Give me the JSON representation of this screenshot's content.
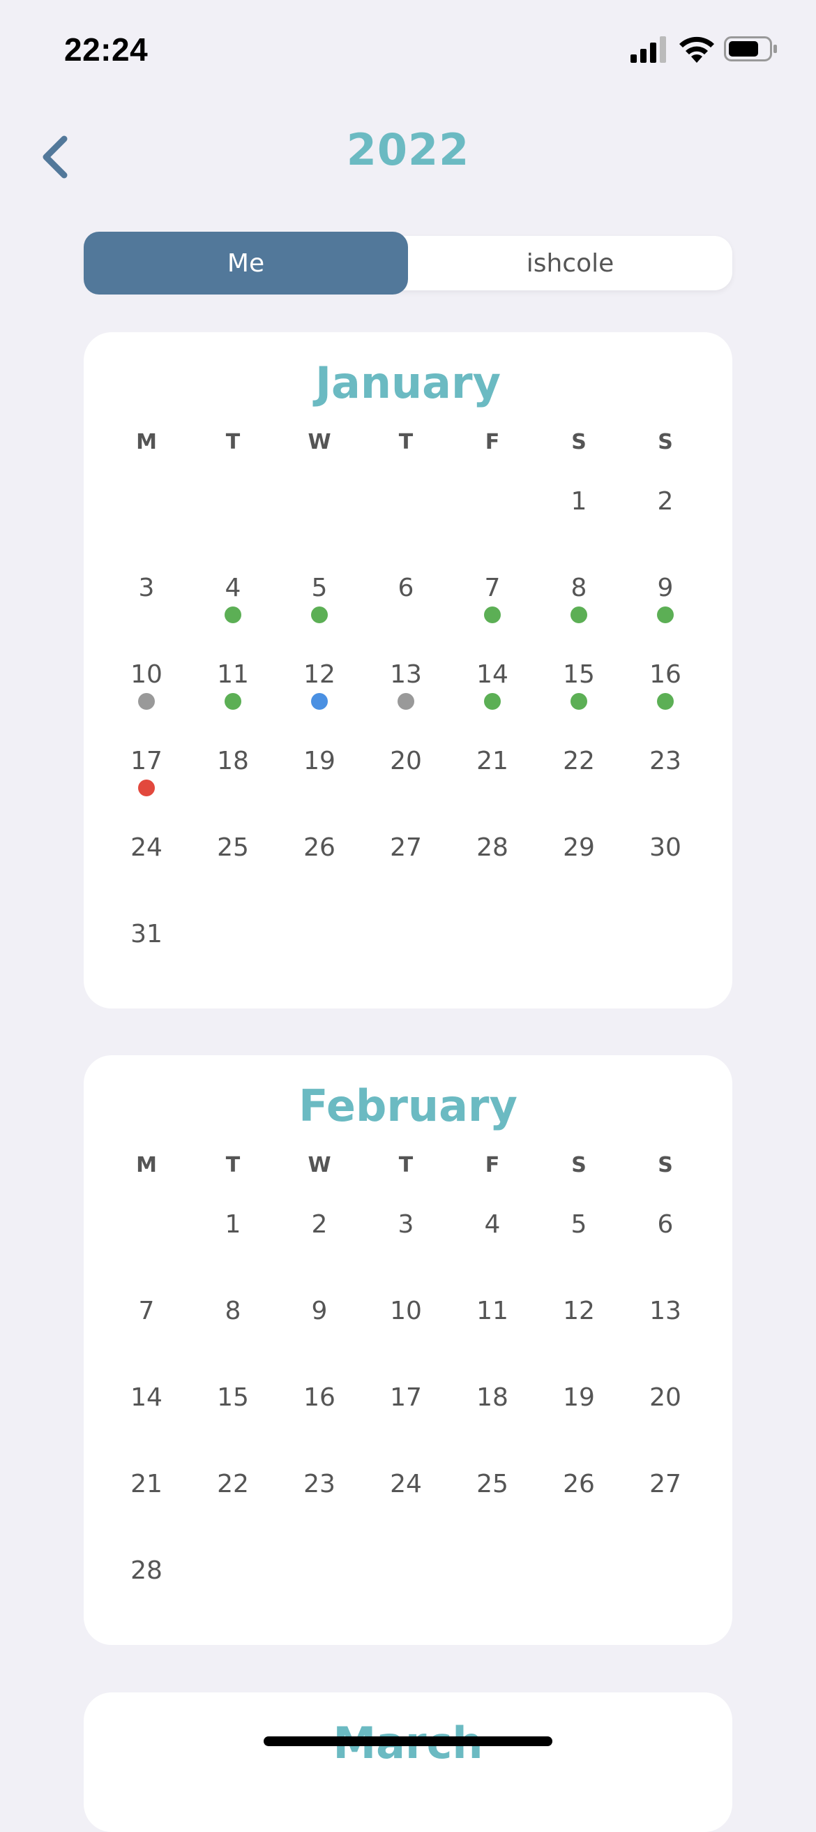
{
  "status": {
    "time": "22:24"
  },
  "header": {
    "title": "2022",
    "back_icon": "chevron-left-icon"
  },
  "segments": {
    "me": "Me",
    "other": "ishcole"
  },
  "weekdays": [
    "M",
    "T",
    "W",
    "T",
    "F",
    "S",
    "S"
  ],
  "colors": {
    "accent": "#6bbac2",
    "selected_segment": "#52789a",
    "dot_green": "#5caf55",
    "dot_gray": "#999999",
    "dot_blue": "#4a90e2",
    "dot_red": "#e2483d"
  },
  "months": [
    {
      "name": "January",
      "weeks": [
        [
          null,
          null,
          null,
          null,
          null,
          {
            "d": "1"
          },
          {
            "d": "2"
          }
        ],
        [
          {
            "d": "3"
          },
          {
            "d": "4",
            "dot": "green"
          },
          {
            "d": "5",
            "dot": "green"
          },
          {
            "d": "6"
          },
          {
            "d": "7",
            "dot": "green"
          },
          {
            "d": "8",
            "dot": "green"
          },
          {
            "d": "9",
            "dot": "green"
          }
        ],
        [
          {
            "d": "10",
            "dot": "gray"
          },
          {
            "d": "11",
            "dot": "green"
          },
          {
            "d": "12",
            "dot": "blue"
          },
          {
            "d": "13",
            "dot": "gray"
          },
          {
            "d": "14",
            "dot": "green"
          },
          {
            "d": "15",
            "dot": "green"
          },
          {
            "d": "16",
            "dot": "green"
          }
        ],
        [
          {
            "d": "17",
            "dot": "red"
          },
          {
            "d": "18"
          },
          {
            "d": "19"
          },
          {
            "d": "20"
          },
          {
            "d": "21"
          },
          {
            "d": "22"
          },
          {
            "d": "23"
          }
        ],
        [
          {
            "d": "24"
          },
          {
            "d": "25"
          },
          {
            "d": "26"
          },
          {
            "d": "27"
          },
          {
            "d": "28"
          },
          {
            "d": "29"
          },
          {
            "d": "30"
          }
        ],
        [
          {
            "d": "31"
          },
          null,
          null,
          null,
          null,
          null,
          null
        ]
      ]
    },
    {
      "name": "February",
      "weeks": [
        [
          null,
          {
            "d": "1"
          },
          {
            "d": "2"
          },
          {
            "d": "3"
          },
          {
            "d": "4"
          },
          {
            "d": "5"
          },
          {
            "d": "6"
          }
        ],
        [
          {
            "d": "7"
          },
          {
            "d": "8"
          },
          {
            "d": "9"
          },
          {
            "d": "10"
          },
          {
            "d": "11"
          },
          {
            "d": "12"
          },
          {
            "d": "13"
          }
        ],
        [
          {
            "d": "14"
          },
          {
            "d": "15"
          },
          {
            "d": "16"
          },
          {
            "d": "17"
          },
          {
            "d": "18"
          },
          {
            "d": "19"
          },
          {
            "d": "20"
          }
        ],
        [
          {
            "d": "21"
          },
          {
            "d": "22"
          },
          {
            "d": "23"
          },
          {
            "d": "24"
          },
          {
            "d": "25"
          },
          {
            "d": "26"
          },
          {
            "d": "27"
          }
        ],
        [
          {
            "d": "28"
          },
          null,
          null,
          null,
          null,
          null,
          null
        ]
      ]
    },
    {
      "name": "March",
      "weeks": []
    }
  ]
}
